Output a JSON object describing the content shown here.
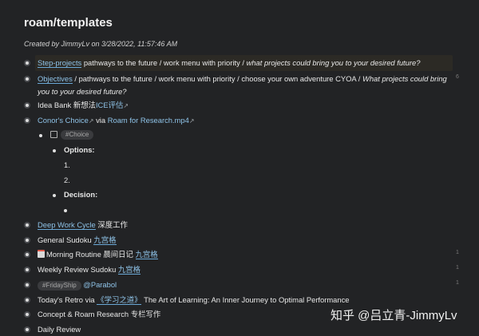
{
  "page": {
    "title": "roam/templates",
    "created": "Created by JimmyLv on 3/28/2022, 11:57:46 AM"
  },
  "rows": {
    "step": {
      "link": "Step-projects",
      "text": " pathways to the future / work menu with priority / ",
      "italic": "what projects could bring you to your desired future?"
    },
    "objectives": {
      "link": "Objectives",
      "text": " / pathways to the future / work menu with priority / choose your own adventure CYOA / ",
      "italic": "What projects could bring you to your desired future?",
      "count": "6"
    },
    "ideabank": {
      "text": "Idea Bank 新想法",
      "link": "ICE评估",
      "arrow": "↗"
    },
    "conor": {
      "link": "Conor's Choice",
      "arrow": "↗",
      "via": " via ",
      "link2": "Roam for Research.mp4",
      "arrow2": "↗"
    },
    "choice_tag": "#Choice",
    "options_label": "Options:",
    "opt1": "1.",
    "opt2": "2.",
    "decision_label": "Decision:",
    "deepwork": {
      "link": "Deep Work Cycle",
      "text": " 深度工作"
    },
    "sudoku": {
      "text": "General Sudoku ",
      "link": "九宫格"
    },
    "morning": {
      "text": "Morning Routine 晨间日记 ",
      "link": "九宫格",
      "count": "1"
    },
    "weekly": {
      "text": "Weekly Review Sudoku ",
      "link": "九宫格",
      "count": "1"
    },
    "friday": {
      "tag": "#FridayShip",
      "link": "@Parabol",
      "count": "1"
    },
    "retro": {
      "text": "Today's Retro via ",
      "link": "《学习之道》",
      "text2": " The Art of Learning: An Inner Journey to Optimal Performance"
    },
    "concept": {
      "text": "Concept & Roam Research 专栏写作"
    },
    "daily": {
      "text": "Daily Review"
    }
  },
  "watermark": "知乎 @吕立青-JimmyLv",
  "icons": {
    "morning": "calendar-icon"
  }
}
